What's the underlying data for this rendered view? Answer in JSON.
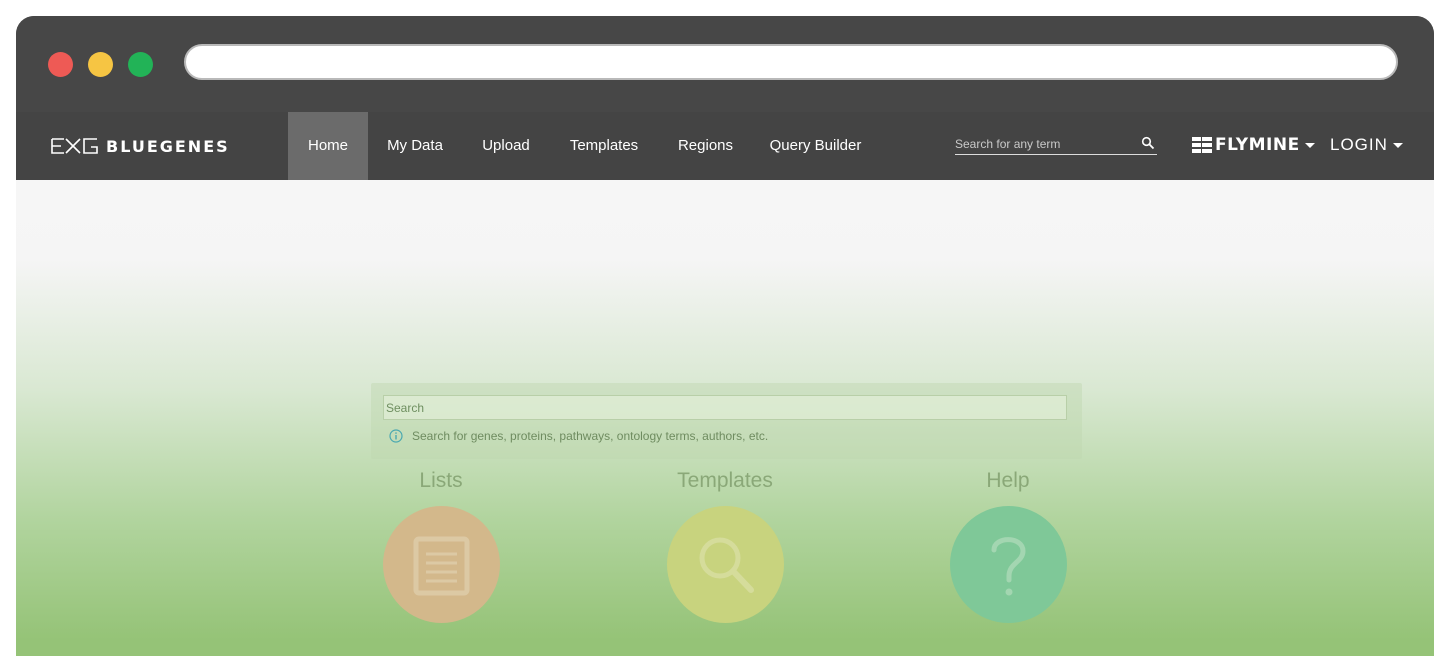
{
  "browser": {
    "url": ""
  },
  "navbar": {
    "logo_text": "BLUEGENES",
    "tabs": [
      {
        "label": "Home",
        "active": true
      },
      {
        "label": "My Data",
        "active": false
      },
      {
        "label": "Upload",
        "active": false
      },
      {
        "label": "Templates",
        "active": false
      },
      {
        "label": "Regions",
        "active": false
      },
      {
        "label": "Query Builder",
        "active": false
      }
    ],
    "search_placeholder": "Search for any term",
    "mine_name": "FLYMINE",
    "login_label": "LOGIN"
  },
  "main": {
    "search_placeholder": "Search",
    "search_hint": "Search for genes, proteins, pathways, ontology terms, authors, etc.",
    "features": [
      {
        "title": "Lists",
        "icon": "document-icon",
        "color": "#d3b88b"
      },
      {
        "title": "Templates",
        "icon": "magnifier-icon",
        "color": "#c8d37e"
      },
      {
        "title": "Help",
        "icon": "question-icon",
        "color": "#7fc898"
      }
    ]
  },
  "colors": {
    "navbar": "#444444",
    "active_tab": "#6b6b6b",
    "window_close": "#ee5a55",
    "window_minimize": "#f6c543",
    "window_zoom": "#22b357"
  }
}
